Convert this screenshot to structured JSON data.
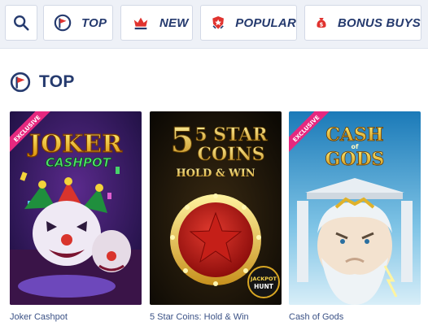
{
  "nav": {
    "search_icon": "search-icon",
    "categories": [
      {
        "label": "TOP",
        "icon": "flag-icon"
      },
      {
        "label": "NEW",
        "icon": "crown-icon"
      },
      {
        "label": "POPULAR",
        "icon": "star-badge-icon"
      },
      {
        "label": "BONUS BUYS",
        "icon": "money-bag-icon"
      }
    ]
  },
  "section": {
    "title": "TOP",
    "icon": "flag-icon"
  },
  "games": [
    {
      "name": "Joker Cashpot",
      "badge": "EXCLUSIVE",
      "logo_line1": "JOKER",
      "logo_line2": "CASHPOT"
    },
    {
      "name": "5 Star Coins: Hold & Win",
      "logo_line1": "5 STAR",
      "logo_line2": "COINS",
      "logo_line3": "HOLD & WIN",
      "corner_badge_1": "JACKPOT",
      "corner_badge_2": "HUNT"
    },
    {
      "name": "Cash of Gods",
      "badge": "EXCLUSIVE",
      "logo_line1": "CASH",
      "logo_small": "of",
      "logo_line2": "GODS"
    }
  ],
  "colors": {
    "brand_navy": "#253a6e",
    "accent_red": "#e0332f",
    "link_blue": "#3b5286",
    "topbar_bg": "#eef1f7"
  }
}
